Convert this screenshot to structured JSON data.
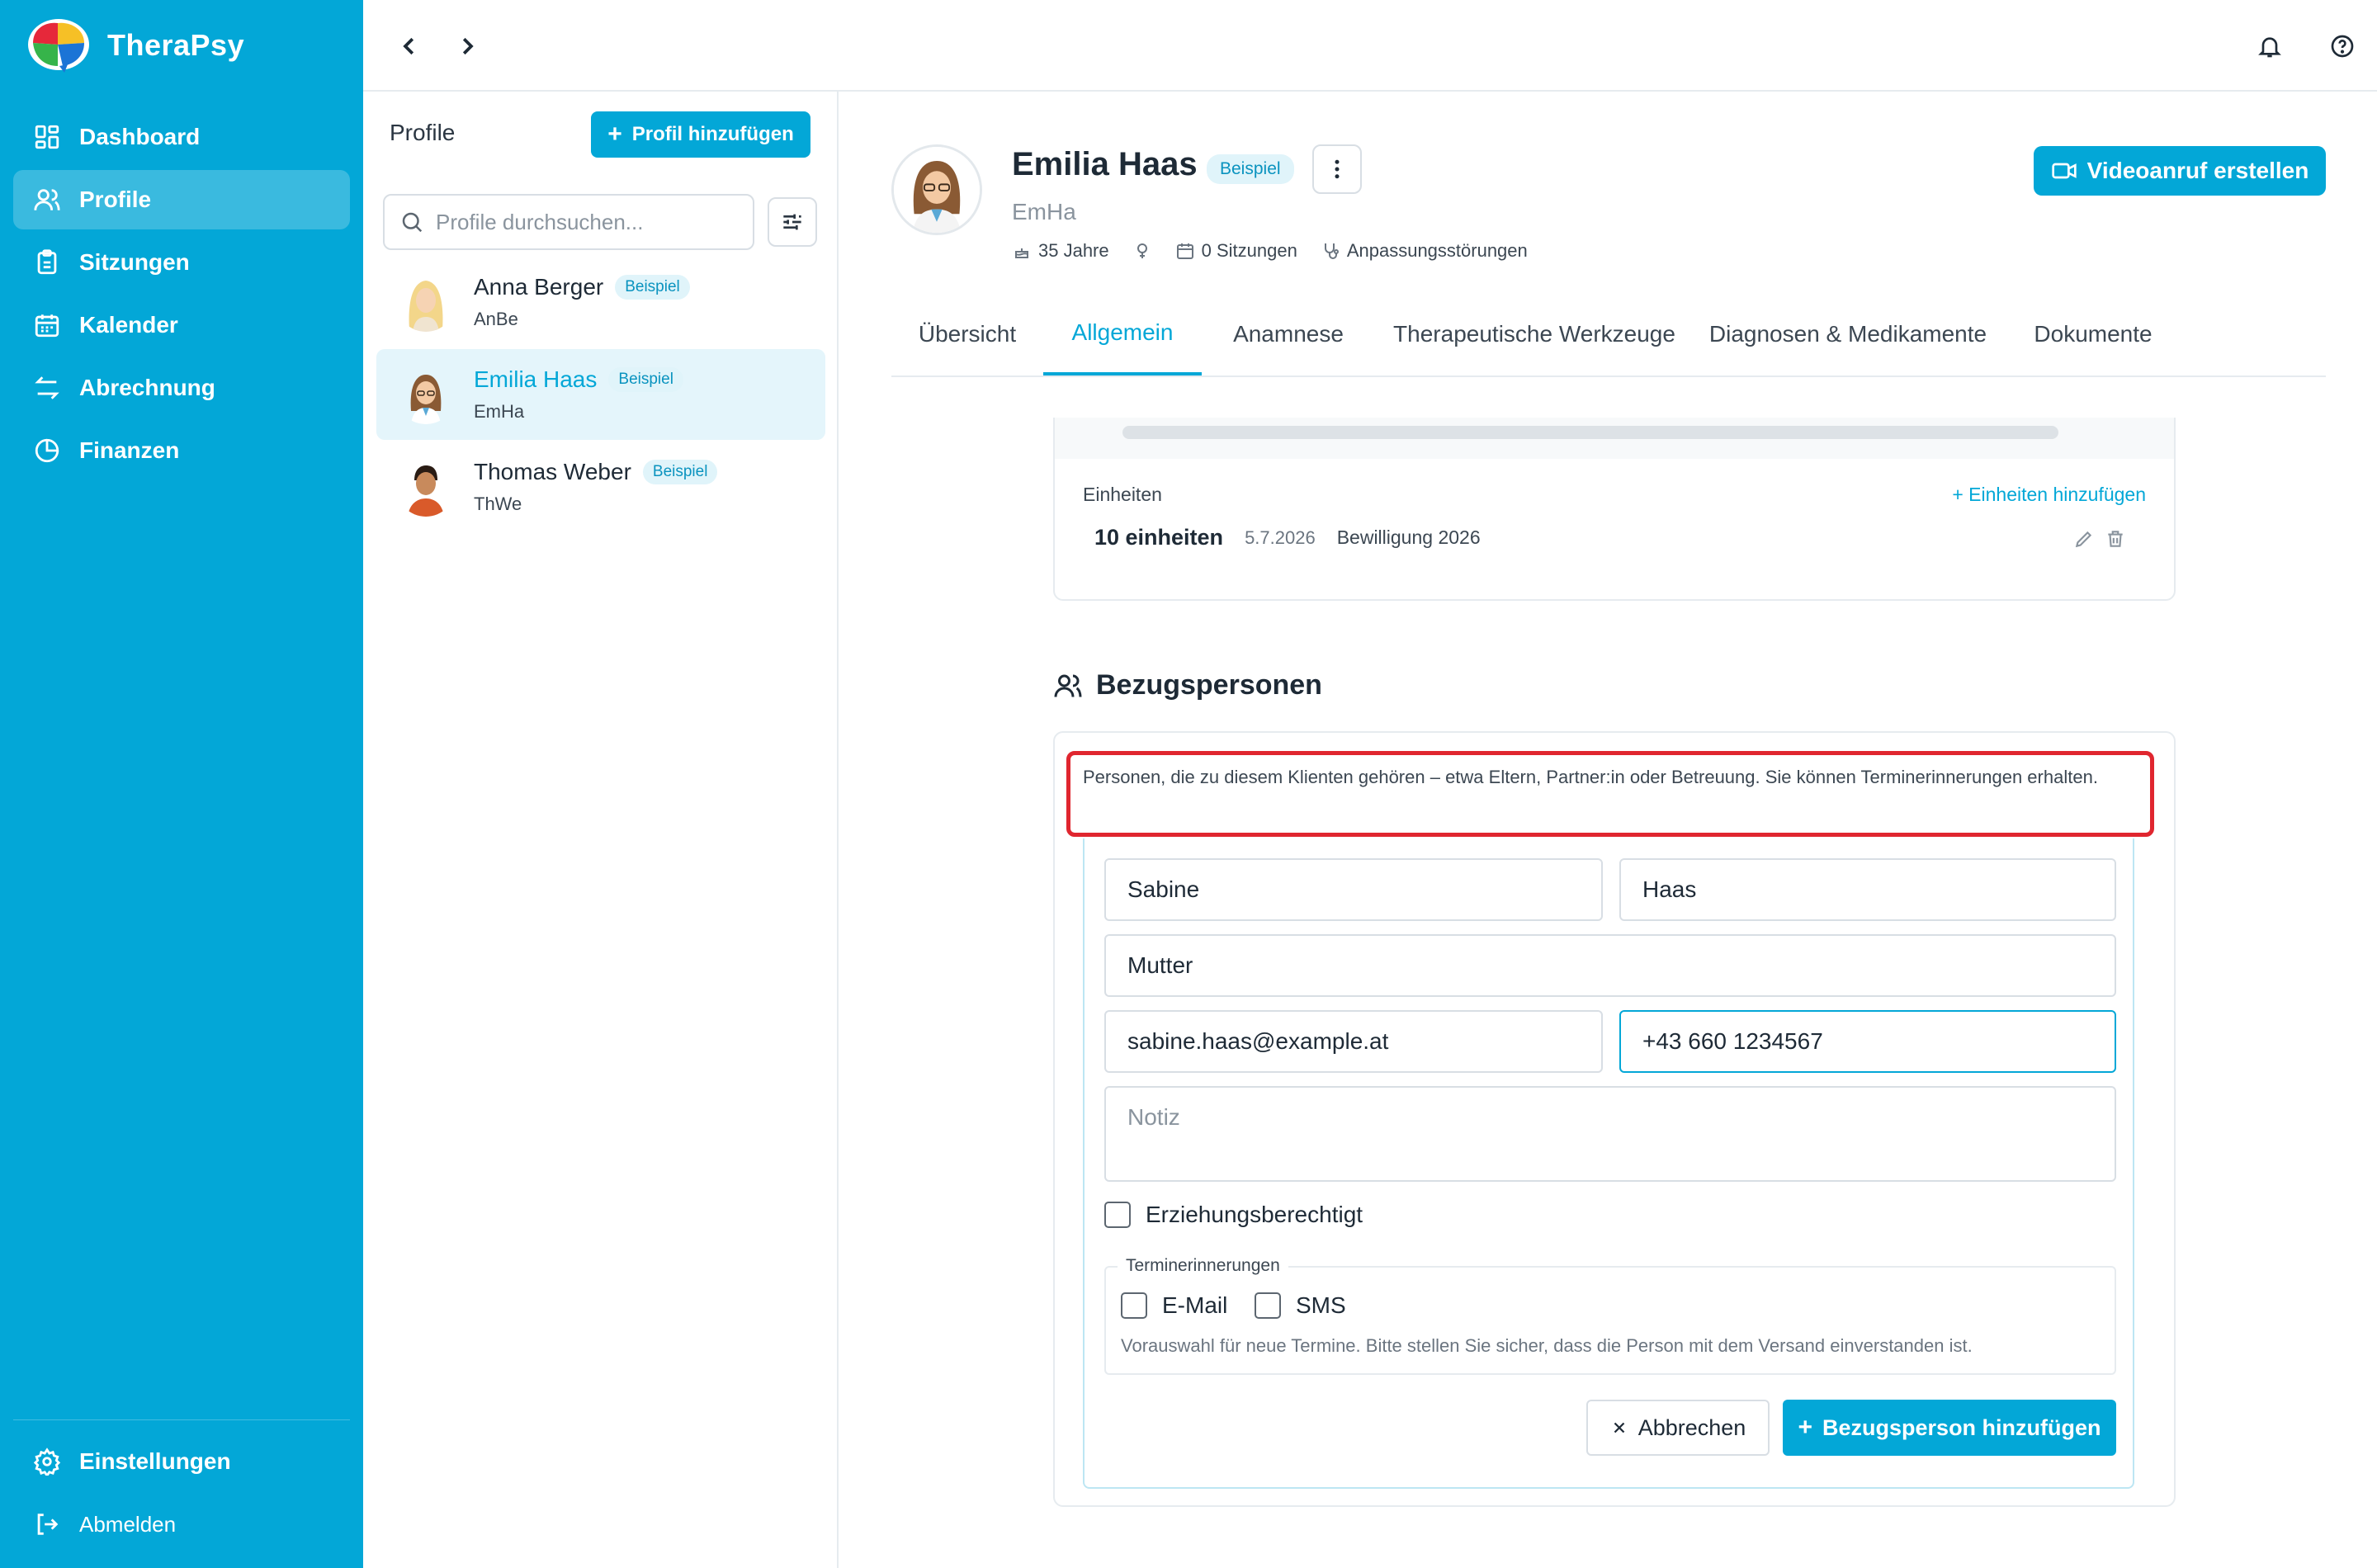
{
  "app": {
    "name": "TheraPsy",
    "colors": {
      "brand": "#03a7d7",
      "highlight": "#e0262f"
    }
  },
  "sidebar": {
    "items": [
      {
        "label": "Dashboard",
        "icon": "dashboard-icon",
        "active": false
      },
      {
        "label": "Profile",
        "icon": "users-icon",
        "active": true
      },
      {
        "label": "Sitzungen",
        "icon": "clipboard-icon",
        "active": false
      },
      {
        "label": "Kalender",
        "icon": "calendar-icon",
        "active": false
      },
      {
        "label": "Abrechnung",
        "icon": "exchange-icon",
        "active": false
      },
      {
        "label": "Finanzen",
        "icon": "pie-chart-icon",
        "active": false
      }
    ],
    "settings_label": "Einstellungen",
    "logout_label": "Abmelden"
  },
  "profile_list": {
    "title": "Profile",
    "add_button": "Profil hinzufügen",
    "search_placeholder": "Profile durchsuchen...",
    "profiles": [
      {
        "name": "Anna Berger",
        "badge": "Beispiel",
        "short": "AnBe",
        "active": false
      },
      {
        "name": "Emilia Haas",
        "badge": "Beispiel",
        "short": "EmHa",
        "active": true
      },
      {
        "name": "Thomas Weber",
        "badge": "Beispiel",
        "short": "ThWe",
        "active": false
      }
    ]
  },
  "client": {
    "name": "Emilia Haas",
    "badge": "Beispiel",
    "short": "EmHa",
    "age": "35 Jahre",
    "sessions": "0 Sitzungen",
    "diagnosis": "Anpassungsstörungen",
    "video_button": "Videoanruf erstellen"
  },
  "tabs": [
    "Übersicht",
    "Allgemein",
    "Anamnese",
    "Therapeutische Werkzeuge",
    "Diagnosen & Medikamente",
    "Dokumente"
  ],
  "active_tab": "Allgemein",
  "units": {
    "label": "Einheiten",
    "add_label": "Einheiten hinzufügen",
    "entry": {
      "count": "10 einheiten",
      "date": "5.7.2026",
      "note": "Bewilligung 2026"
    }
  },
  "contacts": {
    "title": "Bezugspersonen",
    "info": "Personen, die zu diesem Klienten gehören – etwa Eltern, Partner:in oder Betreuung. Sie können Terminerinnerungen erhalten.",
    "form": {
      "first_name": "Sabine",
      "last_name": "Haas",
      "relation": "Mutter",
      "email": "sabine.haas@example.at",
      "phone": "+43 660 1234567",
      "note_placeholder": "Notiz",
      "guardian_label": "Erziehungsberechtigt",
      "reminders_legend": "Terminerinnerungen",
      "email_label": "E-Mail",
      "sms_label": "SMS",
      "reminders_hint": "Vorauswahl für neue Termine. Bitte stellen Sie sicher, dass die Person mit dem Versand einverstanden ist.",
      "cancel_label": "Abbrechen",
      "submit_label": "Bezugsperson hinzufügen"
    }
  }
}
